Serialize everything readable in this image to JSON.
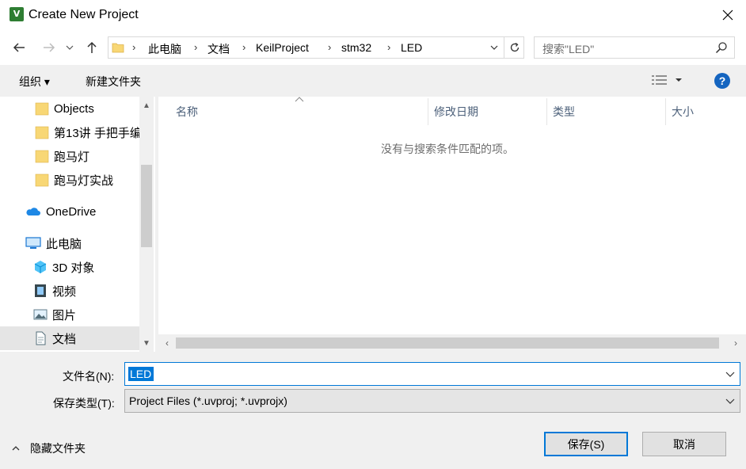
{
  "window": {
    "title": "Create New Project",
    "app_icon": "keil-uvision-icon"
  },
  "breadcrumb": [
    "此电脑",
    "文档",
    "KeilProject",
    "stm32",
    "LED"
  ],
  "search": {
    "placeholder": "搜索\"LED\""
  },
  "toolbar": {
    "organize": "组织 ▾",
    "new_folder": "新建文件夹"
  },
  "nav_items": [
    {
      "label": "Objects",
      "icon": "folder-icon"
    },
    {
      "label": "第13讲 手把手编",
      "icon": "folder-icon"
    },
    {
      "label": "跑马灯",
      "icon": "folder-icon"
    },
    {
      "label": "跑马灯实战",
      "icon": "folder-icon"
    },
    {
      "label": "OneDrive",
      "icon": "cloud-icon"
    },
    {
      "label": "此电脑",
      "icon": "computer-icon"
    },
    {
      "label": "3D 对象",
      "icon": "cube-3d-icon"
    },
    {
      "label": "视频",
      "icon": "video-icon"
    },
    {
      "label": "图片",
      "icon": "picture-icon"
    },
    {
      "label": "文档",
      "icon": "document-icon"
    }
  ],
  "columns": [
    "名称",
    "修改日期",
    "类型",
    "大小"
  ],
  "empty_message": "没有与搜索条件匹配的项。",
  "form": {
    "filename_label": "文件名(N):",
    "filename_value": "LED",
    "filetype_label": "保存类型(T):",
    "filetype_value": "Project Files (*.uvproj; *.uvprojx)"
  },
  "footer": {
    "hide_folders": "隐藏文件夹",
    "save": "保存(S)",
    "cancel": "取消"
  },
  "colors": {
    "accent": "#0078d7",
    "folder": "#f8d775",
    "help": "#1565c0"
  }
}
